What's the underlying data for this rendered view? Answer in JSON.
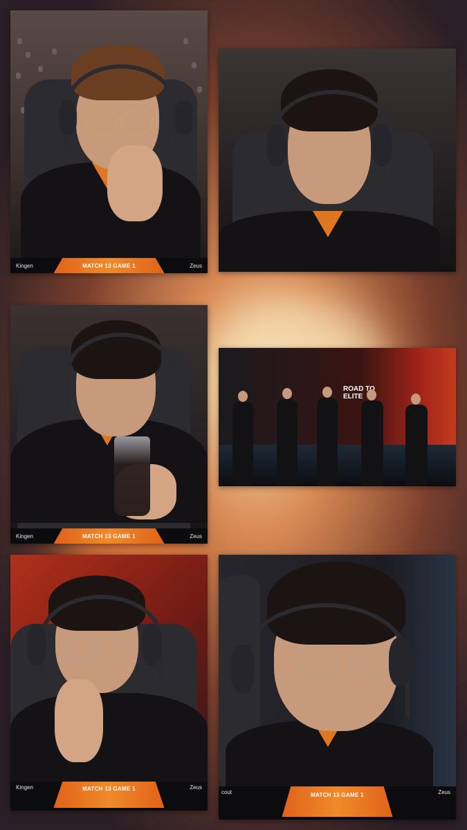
{
  "scorebar": {
    "left_team": "Kingen",
    "right_team": "Zeus",
    "match": "MATCH 13 GAME 1"
  },
  "tile6_left": "cout",
  "stage": {
    "logo": "ROAD TO ELITE"
  },
  "colors": {
    "accent": "#e0761f",
    "bar_orange": "#f08a2a"
  }
}
